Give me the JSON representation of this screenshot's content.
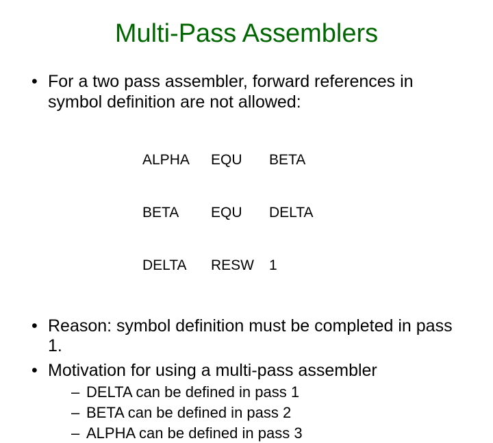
{
  "title": "Multi-Pass Assemblers",
  "bullets": [
    "For a two pass assembler, forward references in symbol definition are not allowed:",
    "Reason: symbol definition must be completed in pass 1.",
    "Motivation for using a multi-pass assembler"
  ],
  "code": [
    {
      "label": "ALPHA",
      "op": "EQU",
      "operand": "BETA"
    },
    {
      "label": "BETA",
      "op": "EQU",
      "operand": "DELTA"
    },
    {
      "label": "DELTA",
      "op": "RESW",
      "operand": "1"
    }
  ],
  "subbullets": [
    "DELTA can be defined in pass 1",
    "BETA can be defined in pass 2",
    "ALPHA can be defined in pass 3"
  ]
}
